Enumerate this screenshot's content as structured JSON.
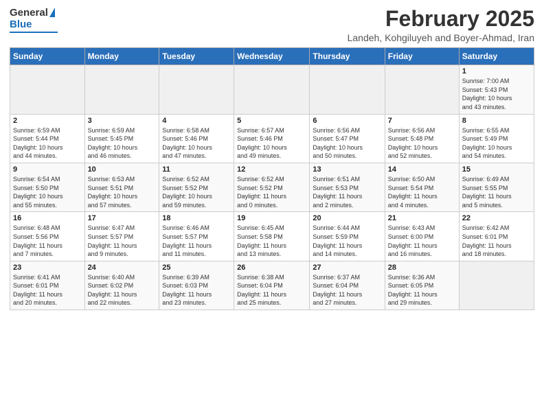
{
  "logo": {
    "general": "General",
    "blue": "Blue"
  },
  "header": {
    "month": "February 2025",
    "location": "Landeh, Kohgiluyeh and Boyer-Ahmad, Iran"
  },
  "days_of_week": [
    "Sunday",
    "Monday",
    "Tuesday",
    "Wednesday",
    "Thursday",
    "Friday",
    "Saturday"
  ],
  "weeks": [
    [
      {
        "day": "",
        "info": ""
      },
      {
        "day": "",
        "info": ""
      },
      {
        "day": "",
        "info": ""
      },
      {
        "day": "",
        "info": ""
      },
      {
        "day": "",
        "info": ""
      },
      {
        "day": "",
        "info": ""
      },
      {
        "day": "1",
        "info": "Sunrise: 7:00 AM\nSunset: 5:43 PM\nDaylight: 10 hours\nand 43 minutes."
      }
    ],
    [
      {
        "day": "2",
        "info": "Sunrise: 6:59 AM\nSunset: 5:44 PM\nDaylight: 10 hours\nand 44 minutes."
      },
      {
        "day": "3",
        "info": "Sunrise: 6:59 AM\nSunset: 5:45 PM\nDaylight: 10 hours\nand 46 minutes."
      },
      {
        "day": "4",
        "info": "Sunrise: 6:58 AM\nSunset: 5:46 PM\nDaylight: 10 hours\nand 47 minutes."
      },
      {
        "day": "5",
        "info": "Sunrise: 6:57 AM\nSunset: 5:46 PM\nDaylight: 10 hours\nand 49 minutes."
      },
      {
        "day": "6",
        "info": "Sunrise: 6:56 AM\nSunset: 5:47 PM\nDaylight: 10 hours\nand 50 minutes."
      },
      {
        "day": "7",
        "info": "Sunrise: 6:56 AM\nSunset: 5:48 PM\nDaylight: 10 hours\nand 52 minutes."
      },
      {
        "day": "8",
        "info": "Sunrise: 6:55 AM\nSunset: 5:49 PM\nDaylight: 10 hours\nand 54 minutes."
      }
    ],
    [
      {
        "day": "9",
        "info": "Sunrise: 6:54 AM\nSunset: 5:50 PM\nDaylight: 10 hours\nand 55 minutes."
      },
      {
        "day": "10",
        "info": "Sunrise: 6:53 AM\nSunset: 5:51 PM\nDaylight: 10 hours\nand 57 minutes."
      },
      {
        "day": "11",
        "info": "Sunrise: 6:52 AM\nSunset: 5:52 PM\nDaylight: 10 hours\nand 59 minutes."
      },
      {
        "day": "12",
        "info": "Sunrise: 6:52 AM\nSunset: 5:52 PM\nDaylight: 11 hours\nand 0 minutes."
      },
      {
        "day": "13",
        "info": "Sunrise: 6:51 AM\nSunset: 5:53 PM\nDaylight: 11 hours\nand 2 minutes."
      },
      {
        "day": "14",
        "info": "Sunrise: 6:50 AM\nSunset: 5:54 PM\nDaylight: 11 hours\nand 4 minutes."
      },
      {
        "day": "15",
        "info": "Sunrise: 6:49 AM\nSunset: 5:55 PM\nDaylight: 11 hours\nand 5 minutes."
      }
    ],
    [
      {
        "day": "16",
        "info": "Sunrise: 6:48 AM\nSunset: 5:56 PM\nDaylight: 11 hours\nand 7 minutes."
      },
      {
        "day": "17",
        "info": "Sunrise: 6:47 AM\nSunset: 5:57 PM\nDaylight: 11 hours\nand 9 minutes."
      },
      {
        "day": "18",
        "info": "Sunrise: 6:46 AM\nSunset: 5:57 PM\nDaylight: 11 hours\nand 11 minutes."
      },
      {
        "day": "19",
        "info": "Sunrise: 6:45 AM\nSunset: 5:58 PM\nDaylight: 11 hours\nand 13 minutes."
      },
      {
        "day": "20",
        "info": "Sunrise: 6:44 AM\nSunset: 5:59 PM\nDaylight: 11 hours\nand 14 minutes."
      },
      {
        "day": "21",
        "info": "Sunrise: 6:43 AM\nSunset: 6:00 PM\nDaylight: 11 hours\nand 16 minutes."
      },
      {
        "day": "22",
        "info": "Sunrise: 6:42 AM\nSunset: 6:01 PM\nDaylight: 11 hours\nand 18 minutes."
      }
    ],
    [
      {
        "day": "23",
        "info": "Sunrise: 6:41 AM\nSunset: 6:01 PM\nDaylight: 11 hours\nand 20 minutes."
      },
      {
        "day": "24",
        "info": "Sunrise: 6:40 AM\nSunset: 6:02 PM\nDaylight: 11 hours\nand 22 minutes."
      },
      {
        "day": "25",
        "info": "Sunrise: 6:39 AM\nSunset: 6:03 PM\nDaylight: 11 hours\nand 23 minutes."
      },
      {
        "day": "26",
        "info": "Sunrise: 6:38 AM\nSunset: 6:04 PM\nDaylight: 11 hours\nand 25 minutes."
      },
      {
        "day": "27",
        "info": "Sunrise: 6:37 AM\nSunset: 6:04 PM\nDaylight: 11 hours\nand 27 minutes."
      },
      {
        "day": "28",
        "info": "Sunrise: 6:36 AM\nSunset: 6:05 PM\nDaylight: 11 hours\nand 29 minutes."
      },
      {
        "day": "",
        "info": ""
      }
    ]
  ]
}
